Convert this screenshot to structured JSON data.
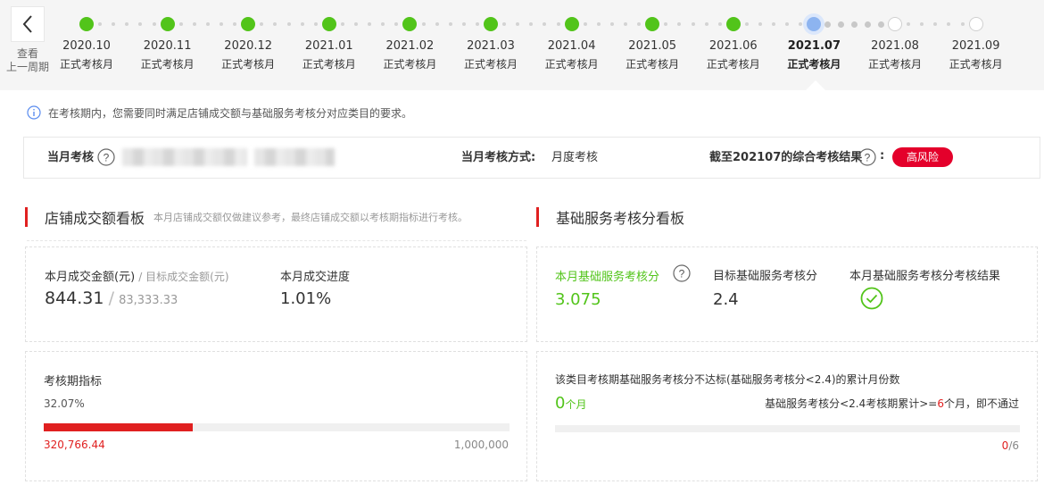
{
  "timeline": {
    "back_label_line1": "查看",
    "back_label_line2": "上一周期",
    "months": [
      {
        "date": "2020.10",
        "status": "正式考核月",
        "state": "done"
      },
      {
        "date": "2020.11",
        "status": "正式考核月",
        "state": "done"
      },
      {
        "date": "2020.12",
        "status": "正式考核月",
        "state": "done"
      },
      {
        "date": "2021.01",
        "status": "正式考核月",
        "state": "done"
      },
      {
        "date": "2021.02",
        "status": "正式考核月",
        "state": "done"
      },
      {
        "date": "2021.03",
        "status": "正式考核月",
        "state": "done"
      },
      {
        "date": "2021.04",
        "status": "正式考核月",
        "state": "done"
      },
      {
        "date": "2021.05",
        "status": "正式考核月",
        "state": "done"
      },
      {
        "date": "2021.06",
        "status": "正式考核月",
        "state": "done"
      },
      {
        "date": "2021.07",
        "status": "正式考核月",
        "state": "current"
      },
      {
        "date": "2021.08",
        "status": "正式考核月",
        "state": "future"
      },
      {
        "date": "2021.09",
        "status": "正式考核月",
        "state": "future"
      }
    ]
  },
  "notice": "在考核期内，您需要同时满足店铺成交额与基础服务考核分对应类目的要求。",
  "summary": {
    "current_label": "当月考核",
    "method_label": "当月考核方式:",
    "method_value": "月度考核",
    "result_label": "截至202107的综合考核结果",
    "result_badge": "高风险"
  },
  "sales_board": {
    "title": "店铺成交额看板",
    "subtitle": "本月店铺成交额仅做建议参考，最终店铺成交额以考核期指标进行考核。",
    "amount_label": "本月成交金额(元)",
    "target_label": "/ 目标成交金额(元)",
    "amount_value": "844.31",
    "target_value": "83,333.33",
    "progress_label": "本月成交进度",
    "progress_value": "1.01%",
    "period_label": "考核期指标",
    "period_percent": "32.07%",
    "period_fraction": 0.3207,
    "period_current": "320,766.44",
    "period_target": "1,000,000"
  },
  "service_board": {
    "title": "基础服务考核分看板",
    "score_label": "本月基础服务考核分",
    "score_value": "3.075",
    "target_label": "目标基础服务考核分",
    "target_value": "2.4",
    "result_label": "本月基础服务考核分考核结果",
    "fail_desc": "该类目考核期基础服务考核分不达标(基础服务考核分<2.4)的累计月份数",
    "fail_count": "0",
    "fail_unit": "个月",
    "rule_pre": "基础服务考核分<2.4考核期累计>=",
    "rule_num": "6",
    "rule_post": "个月，即不通过",
    "fail_num": "0",
    "fail_total": "/6",
    "fail_fraction": 0
  },
  "colors": {
    "green": "#52c41a",
    "red": "#e02020",
    "badge_red": "#e4002b",
    "current_dot": "#8db4f0"
  }
}
